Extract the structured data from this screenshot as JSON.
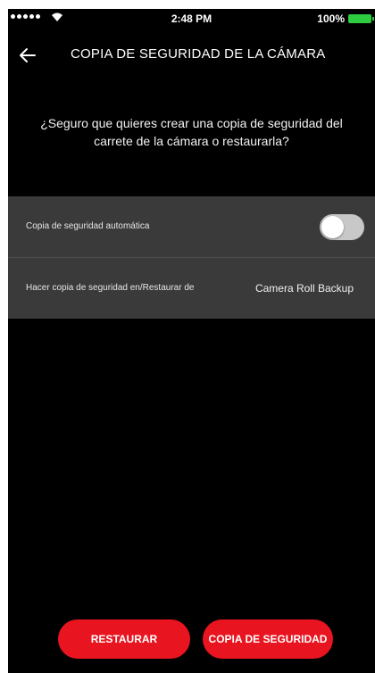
{
  "status_bar": {
    "time": "2:48 PM",
    "battery": "100%"
  },
  "header": {
    "title": "COPIA DE SEGURIDAD DE LA CÁMARA"
  },
  "question": "¿Seguro que quieres crear una copia de seguridad del carrete de la cámara o restaurarla?",
  "settings": {
    "auto_backup": {
      "label": "Copia de seguridad automática",
      "enabled": false
    },
    "backup_location": {
      "label": "Hacer copia de seguridad en/Restaurar de",
      "value": "Camera Roll Backup"
    }
  },
  "buttons": {
    "restore": "RESTAURAR",
    "backup": "COPIA DE SEGURIDAD"
  },
  "colors": {
    "accent": "#e8141f",
    "background": "#000000",
    "panel": "#3a3a3a",
    "battery": "#2ecc40"
  }
}
